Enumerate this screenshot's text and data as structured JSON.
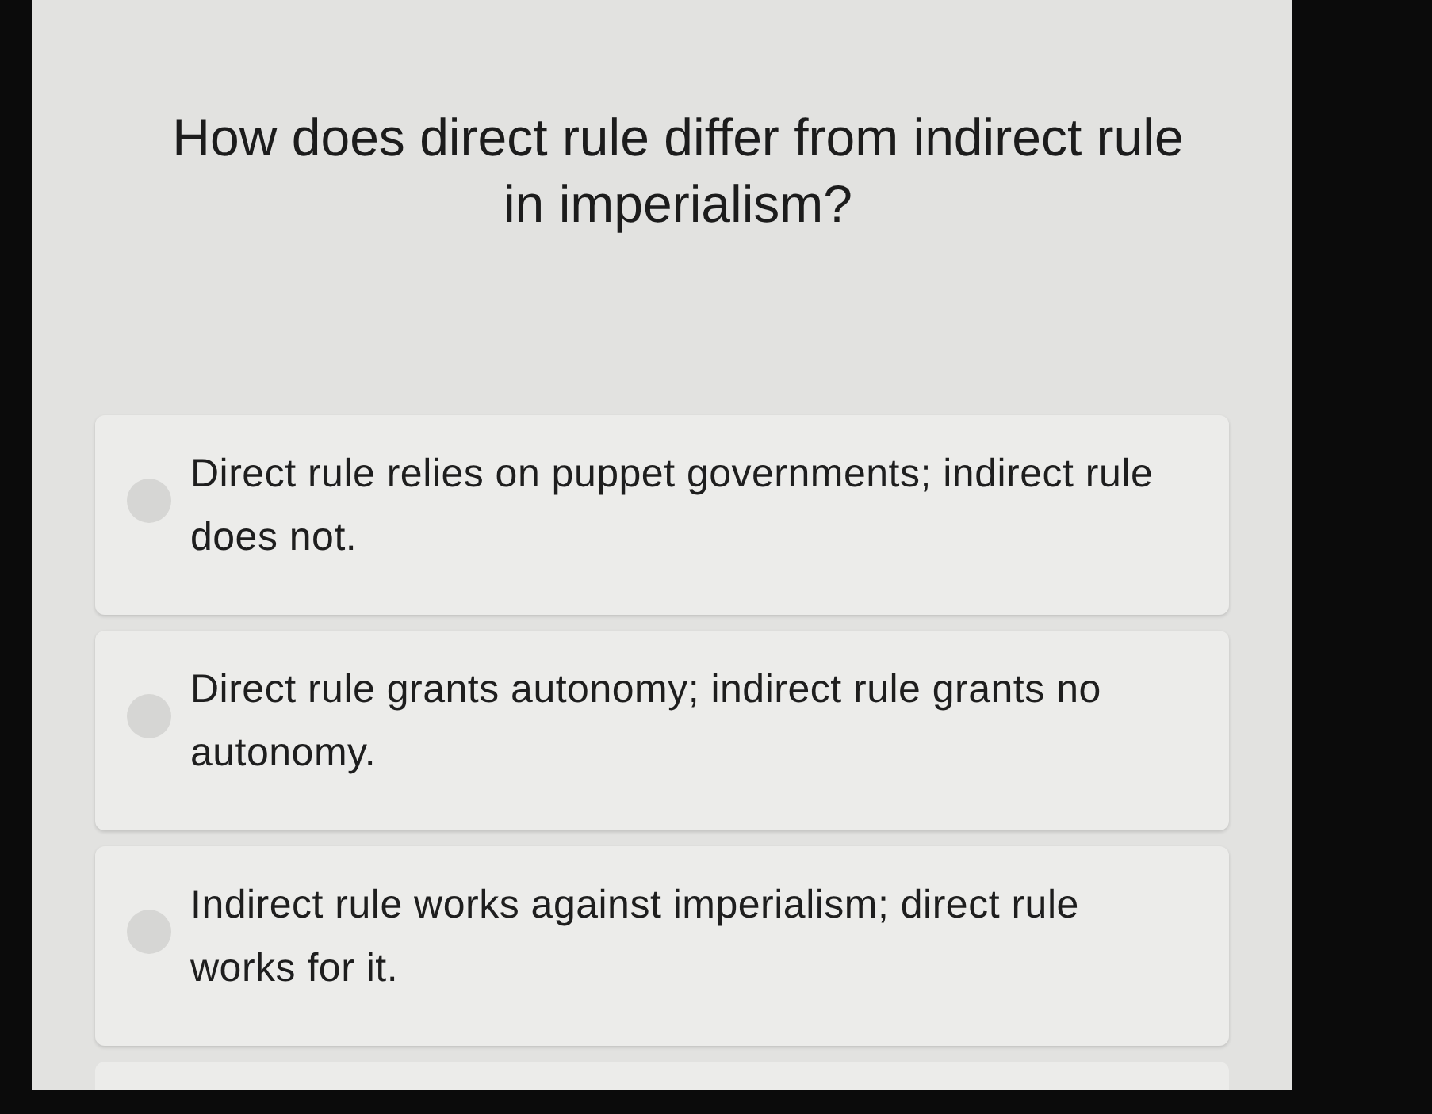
{
  "question": "How does direct rule differ from indirect rule in imperialism?",
  "options": [
    {
      "text": "Direct rule relies on puppet governments; indirect rule does not.",
      "selected": false
    },
    {
      "text": "Direct rule grants autonomy; indirect rule grants no autonomy.",
      "selected": false
    },
    {
      "text": "Indirect rule works against imperialism; direct rule works for it.",
      "selected": false
    }
  ]
}
